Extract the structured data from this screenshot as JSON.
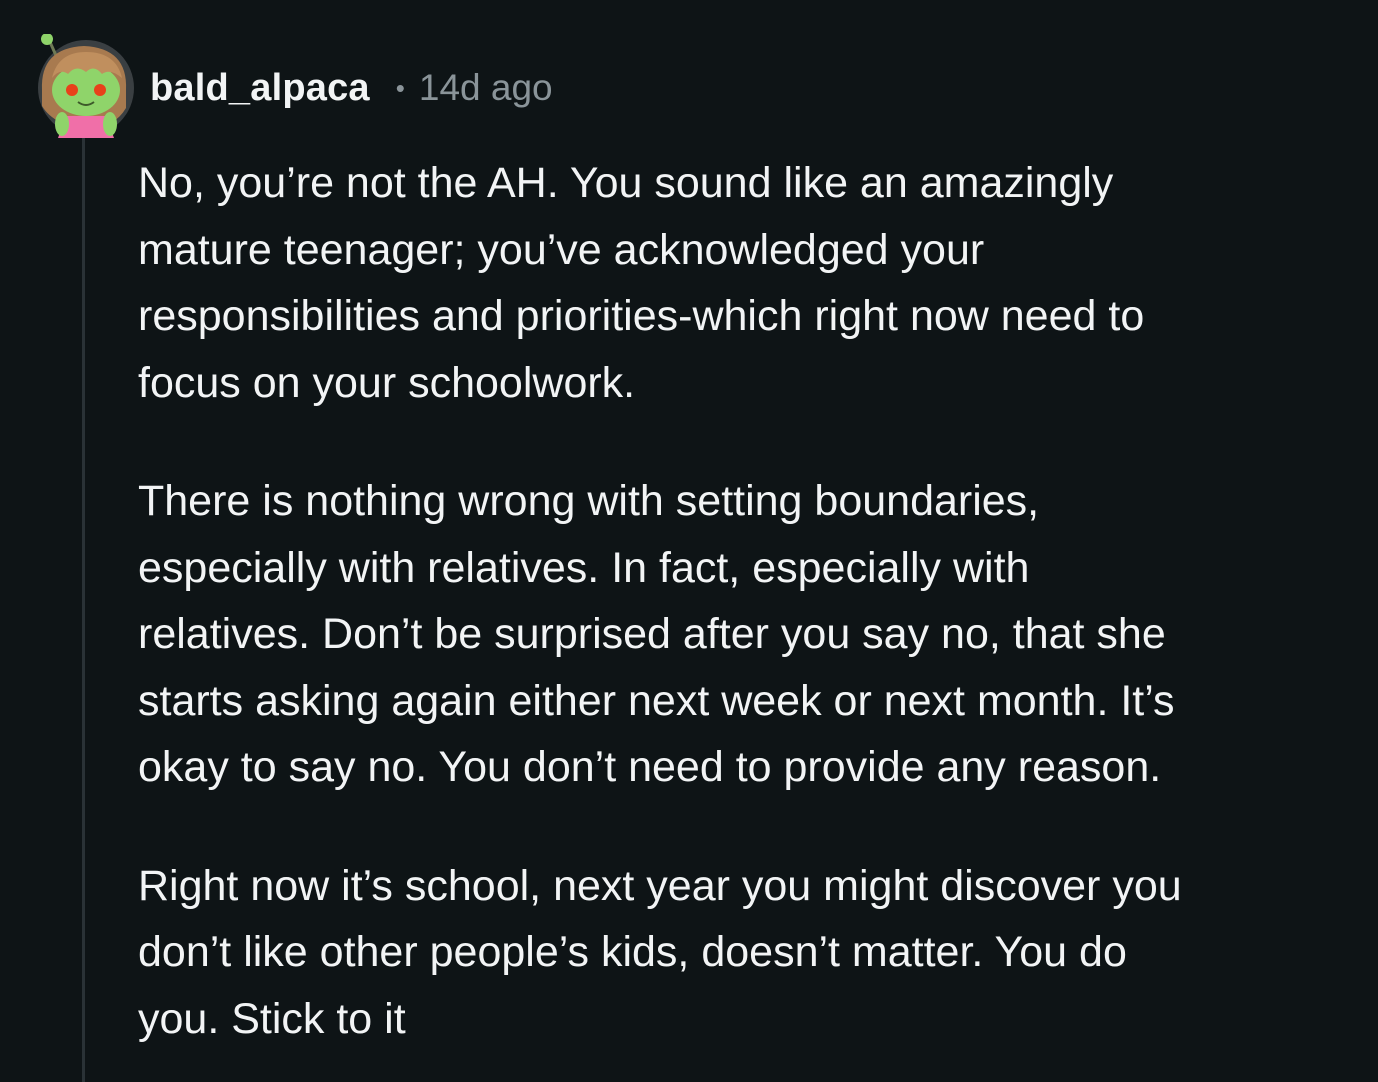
{
  "comment": {
    "username": "bald_alpaca",
    "separator": "•",
    "timestamp": "14d ago",
    "avatar_icon": "snoo-avatar-icon",
    "paragraphs": [
      "No, you’re not the AH. You sound like an amazingly\nmature teenager; you’ve acknowledged your\nresponsibilities and priorities-which right now need to\nfocus on your schoolwork.",
      "There is nothing wrong with setting boundaries,\nespecially with relatives. In fact, especially with\nrelatives. Don’t be surprised after you say no, that she\nstarts asking again either next week or next month. It’s\nokay to say no. You don’t need to provide any reason.",
      "Right now it’s school, next year you might discover you\ndon’t like other people’s kids, doesn’t matter. You do\nyou. Stick to it"
    ]
  },
  "colors": {
    "background": "#0e1416",
    "text": "#f2f4f5",
    "meta": "#8a9499",
    "thread_line": "#2a3236",
    "avatar_green": "#8fd46a",
    "avatar_hair": "#a87a4f",
    "avatar_dress": "#f06fa8",
    "avatar_eye": "#e8411a"
  }
}
